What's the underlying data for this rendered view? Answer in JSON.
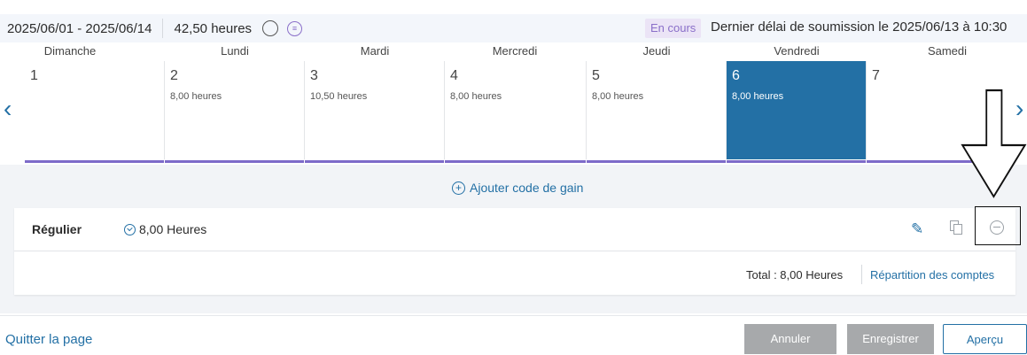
{
  "header": {
    "period": "2025/06/01 - 2025/06/14",
    "total_hours": "42,50 heures",
    "info_icon_glyph": "i",
    "status": "En cours",
    "deadline": "Dernier délai de soumission le 2025/06/13 à 10:30"
  },
  "days": [
    {
      "name": "Dimanche",
      "num": "1",
      "hours": ""
    },
    {
      "name": "Lundi",
      "num": "2",
      "hours": "8,00 heures"
    },
    {
      "name": "Mardi",
      "num": "3",
      "hours": "10,50 heures"
    },
    {
      "name": "Mercredi",
      "num": "4",
      "hours": "8,00 heures"
    },
    {
      "name": "Jeudi",
      "num": "5",
      "hours": "8,00 heures"
    },
    {
      "name": "Vendredi",
      "num": "6",
      "hours": "8,00 heures",
      "selected": true
    },
    {
      "name": "Samedi",
      "num": "7",
      "hours": ""
    }
  ],
  "icons": {
    "nav_left": "‹",
    "nav_right": "›",
    "pencil": "✎",
    "names": [
      "info-icon",
      "comment-icon",
      "chevron-left-icon",
      "chevron-right-icon",
      "plus-circle-icon",
      "clock-icon",
      "pencil-icon",
      "copy-icon",
      "minus-circle-icon",
      "down-arrow-annotation"
    ]
  },
  "panel": {
    "add_code_label": "Ajouter code de gain",
    "entry": {
      "code": "Régulier",
      "hours": "8,00 Heures"
    },
    "total": "Total : 8,00 Heures",
    "accounts_link": "Répartition des comptes"
  },
  "footer": {
    "quit": "Quitter la page",
    "cancel": "Annuler",
    "save": "Enregistrer",
    "preview": "Aperçu"
  },
  "colors": {
    "accent": "#2370a5",
    "selected_day": "#2370a5",
    "status_bg": "#ebe4f6",
    "status_text": "#8a6fc9",
    "disabled_button": "#a7a9ab",
    "day_underline": "#7d6bc9"
  }
}
